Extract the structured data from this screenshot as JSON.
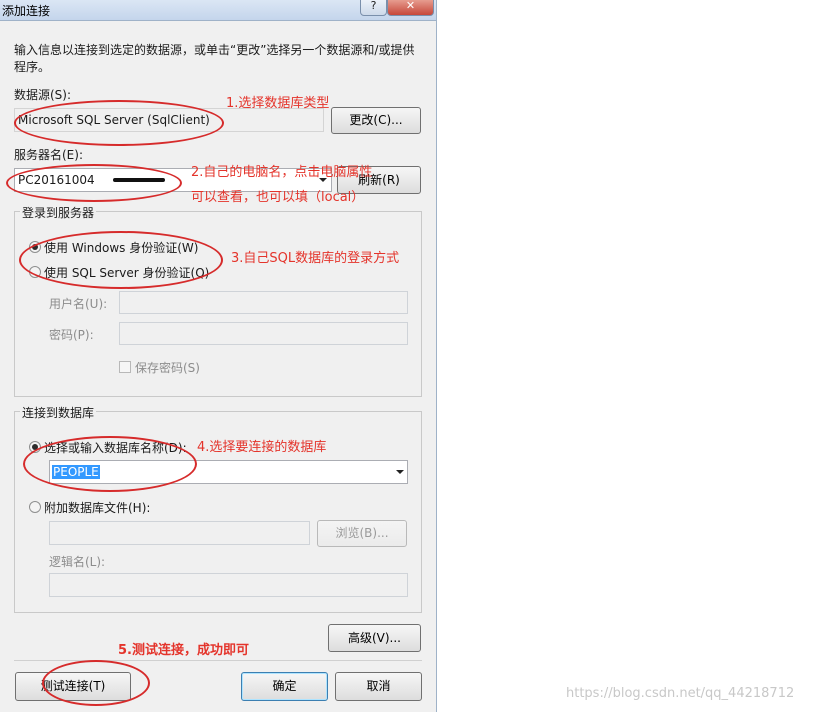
{
  "window": {
    "title": "添加连接",
    "help_label": "?",
    "close_label": "✕"
  },
  "intro": "输入信息以连接到选定的数据源，或单击“更改”选择另一个数据源和/或提供程序。",
  "datasource": {
    "label": "数据源(S):",
    "value": "Microsoft SQL Server (SqlClient)",
    "change_button": "更改(C)..."
  },
  "server": {
    "label": "服务器名(E):",
    "value": "PC20161004",
    "refresh_button": "刷新(R)"
  },
  "login": {
    "group_title": "登录到服务器",
    "windows_auth": "使用 Windows 身份验证(W)",
    "sql_auth": "使用 SQL Server 身份验证(Q)",
    "username_label": "用户名(U):",
    "password_label": "密码(P):",
    "save_password": "保存密码(S)"
  },
  "database": {
    "group_title": "连接到数据库",
    "select_label": "选择或输入数据库名称(D):",
    "selected_db": "PEOPLE",
    "attach_label": "附加数据库文件(H):",
    "browse_button": "浏览(B)...",
    "logical_label": "逻辑名(L):"
  },
  "buttons": {
    "advanced": "高级(V)...",
    "test": "测试连接(T)",
    "ok": "确定",
    "cancel": "取消"
  },
  "annotations": {
    "a1": "1.选择数据库类型",
    "a2_line1": "2.自己的电脑名，点击电脑属性",
    "a2_line2": "可以查看，也可以填（local）",
    "a3": "3.自己SQL数据库的登录方式",
    "a4": "4.选择要连接的数据库",
    "a5": "5.测试连接，成功即可"
  },
  "watermark": "https://blog.csdn.net/qq_44218712",
  "colors": {
    "annotation": "#e4342b",
    "selection": "#3399ff"
  }
}
